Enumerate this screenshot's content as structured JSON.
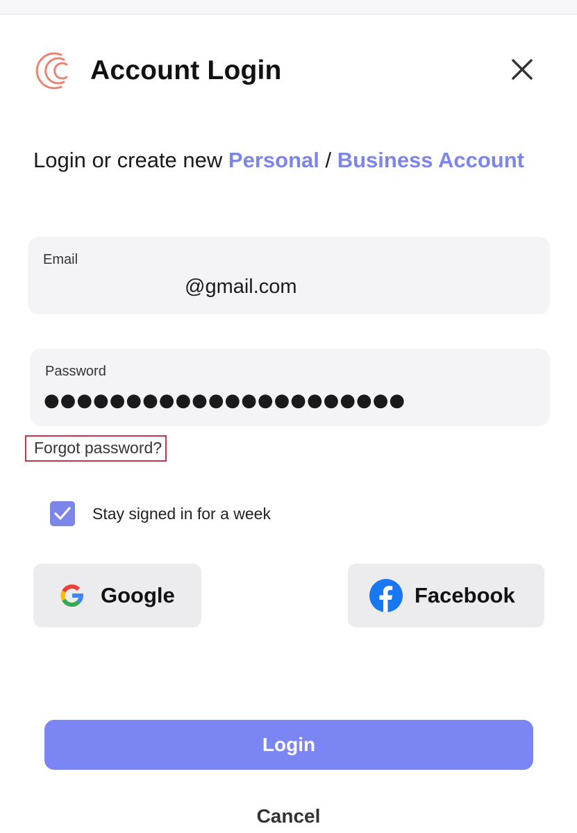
{
  "header": {
    "title": "Account Login",
    "logo_icon": "brand-logo-icon",
    "close_icon": "close-icon"
  },
  "intro": {
    "text_before": "Login or create new ",
    "personal_link": "Personal",
    "separator": " / ",
    "business_link": "Business Account"
  },
  "email": {
    "label": "Email",
    "value": "@gmail.com"
  },
  "password": {
    "label": "Password",
    "value": "●●●●●●●●●●●●●●●●●●●●●●"
  },
  "forgot_password": "Forgot password?",
  "stay_signed_in": {
    "label": "Stay signed in for a week",
    "checked": true
  },
  "social": {
    "google_label": "Google",
    "facebook_label": "Facebook"
  },
  "actions": {
    "login_label": "Login",
    "cancel_label": "Cancel"
  },
  "colors": {
    "accent": "#7b86e8",
    "login_button": "#7b86f4",
    "logo": "#e8846f",
    "facebook": "#1877f2",
    "highlight_border": "#c63445"
  }
}
